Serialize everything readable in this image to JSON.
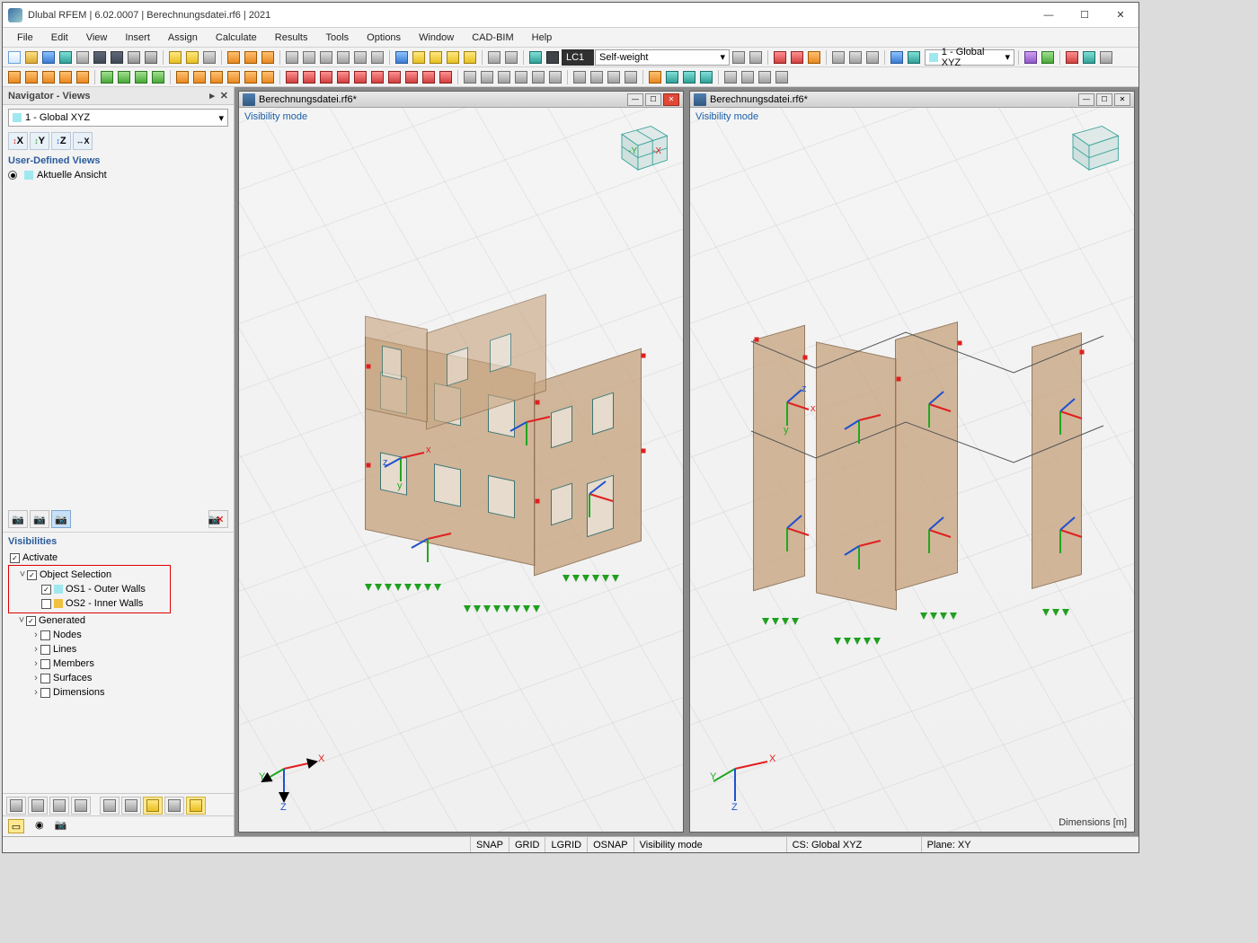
{
  "app": {
    "title_full": "Dlubal RFEM | 6.02.0007 | Berechnungsdatei.rf6 | 2021"
  },
  "menubar": [
    "File",
    "Edit",
    "View",
    "Insert",
    "Assign",
    "Calculate",
    "Results",
    "Tools",
    "Options",
    "Window",
    "CAD-BIM",
    "Help"
  ],
  "loadcase": {
    "id": "LC1",
    "name": "Self-weight"
  },
  "global_combo": "1 - Global XYZ",
  "navigator": {
    "title": "Navigator - Views",
    "combo": "1 - Global XYZ",
    "userviews_label": "User-Defined Views",
    "current_view": "Aktuelle Ansicht",
    "visibilities_label": "Visibilities",
    "activate": "Activate",
    "object_selection": "Object Selection",
    "os1": "OS1 - Outer Walls",
    "os2": "OS2 - Inner Walls",
    "generated": "Generated",
    "nodes": "Nodes",
    "lines": "Lines",
    "members": "Members",
    "surfaces": "Surfaces",
    "dimensions_item": "Dimensions"
  },
  "viewport": {
    "doc_title": "Berechnungsdatei.rf6*",
    "vismode": "Visibility mode",
    "dimensions_unit": "Dimensions [m]"
  },
  "statusbar": {
    "snap": "SNAP",
    "grid": "GRID",
    "lgrid": "LGRID",
    "osnap": "OSNAP",
    "vismode": "Visibility mode",
    "cs": "CS: Global XYZ",
    "plane": "Plane: XY"
  },
  "axis": {
    "x": "X",
    "y": "Y",
    "z": "Z",
    "x_l": "x",
    "y_l": "y",
    "z_l": "z"
  }
}
